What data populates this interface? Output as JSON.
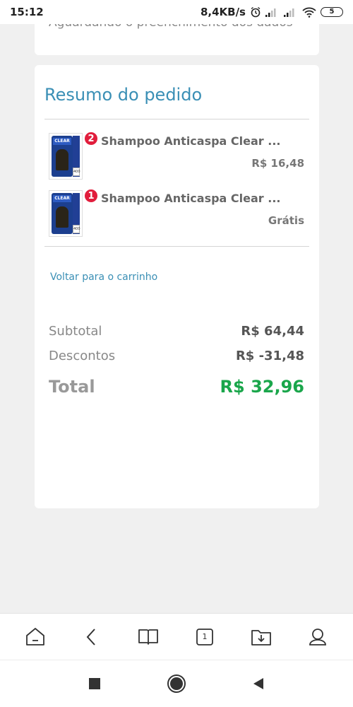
{
  "status_bar": {
    "time": "15:12",
    "speed": "8,4KB/s",
    "battery": "5"
  },
  "top_card": {
    "text": "Aguardando o preenchimento dos dados"
  },
  "summary": {
    "title": "Resumo do pedido",
    "items": [
      {
        "name": "Shampoo Anticaspa Clear ...",
        "quantity": "2",
        "price": "R$ 16,48"
      },
      {
        "name": "Shampoo Anticaspa Clear ...",
        "quantity": "1",
        "price": "Grátis"
      }
    ],
    "back_link": "Voltar para o carrinho",
    "subtotal_label": "Subtotal",
    "subtotal_value": "R$ 64,44",
    "discount_label": "Descontos",
    "discount_value": "R$ -31,48",
    "total_label": "Total",
    "total_value": "R$ 32,96"
  },
  "product_thumb": {
    "brand": "CLEAR",
    "size": "400"
  },
  "browser_bar": {
    "buttons": [
      "home-icon",
      "back-icon",
      "bookmarks-icon",
      "tabs-icon",
      "downloads-icon",
      "profile-icon"
    ],
    "tab_count": "1"
  },
  "nav_bar": {
    "buttons": [
      "recents-icon",
      "home-circle-icon",
      "back-triangle-icon"
    ]
  },
  "colors": {
    "accent": "#3a8fb5",
    "total_green": "#1aa64b",
    "badge_red": "#e11d3c"
  }
}
